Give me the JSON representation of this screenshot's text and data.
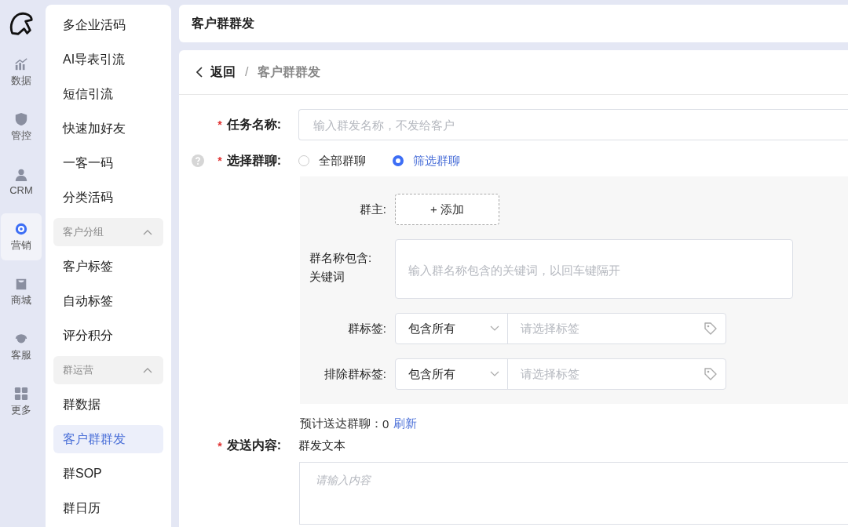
{
  "rail": [
    {
      "label": "数据",
      "selected": false
    },
    {
      "label": "管控",
      "selected": false
    },
    {
      "label": "CRM",
      "selected": false
    },
    {
      "label": "营销",
      "selected": true
    },
    {
      "label": "商城",
      "selected": false
    },
    {
      "label": "客服",
      "selected": false
    },
    {
      "label": "更多",
      "selected": false
    }
  ],
  "menu": [
    {
      "kind": "item",
      "label": "多企业活码",
      "selected": false
    },
    {
      "kind": "item",
      "label": "AI导表引流",
      "selected": false
    },
    {
      "kind": "item",
      "label": "短信引流",
      "selected": false
    },
    {
      "kind": "item",
      "label": "快速加好友",
      "selected": false
    },
    {
      "kind": "item",
      "label": "一客一码",
      "selected": false
    },
    {
      "kind": "item",
      "label": "分类活码",
      "selected": false
    },
    {
      "kind": "group",
      "label": "客户分组",
      "expanded": true
    },
    {
      "kind": "item",
      "label": "客户标签",
      "selected": false
    },
    {
      "kind": "item",
      "label": "自动标签",
      "selected": false
    },
    {
      "kind": "item",
      "label": "评分积分",
      "selected": false
    },
    {
      "kind": "group",
      "label": "群运营",
      "expanded": true
    },
    {
      "kind": "item",
      "label": "群数据",
      "selected": false
    },
    {
      "kind": "item",
      "label": "客户群群发",
      "selected": true
    },
    {
      "kind": "item",
      "label": "群SOP",
      "selected": false
    },
    {
      "kind": "item",
      "label": "群日历",
      "selected": false
    }
  ],
  "page_title": "客户群群发",
  "breadcrumb": {
    "back": "返回",
    "separator": "/",
    "current": "客户群群发"
  },
  "form": {
    "task_name": {
      "required_mark": "*",
      "label": "任务名称:",
      "placeholder": "输入群发名称，不发给客户"
    },
    "select_group": {
      "required_mark": "*",
      "label": "选择群聊:",
      "options": [
        {
          "label": "全部群聊",
          "selected": false
        },
        {
          "label": "筛选群聊",
          "selected": true
        }
      ]
    },
    "filter": {
      "owner": {
        "label": "群主:",
        "button": "+ 添加"
      },
      "keywords": {
        "label": "群名称包含:\n关键词",
        "placeholder": "输入群名称包含的关键词，以回车键隔开"
      },
      "tag_rows": [
        {
          "label": "群标签:",
          "mode": "包含所有",
          "placeholder": "请选择标签"
        },
        {
          "label": "排除群标签:",
          "mode": "包含所有",
          "placeholder": "请选择标签"
        }
      ]
    },
    "estimate": {
      "label": "预计送达群聊：",
      "count": "0",
      "refresh": "刷新"
    },
    "content": {
      "required_mark": "*",
      "label": "发送内容:",
      "type": "群发文本",
      "placeholder": "请输入内容"
    }
  }
}
